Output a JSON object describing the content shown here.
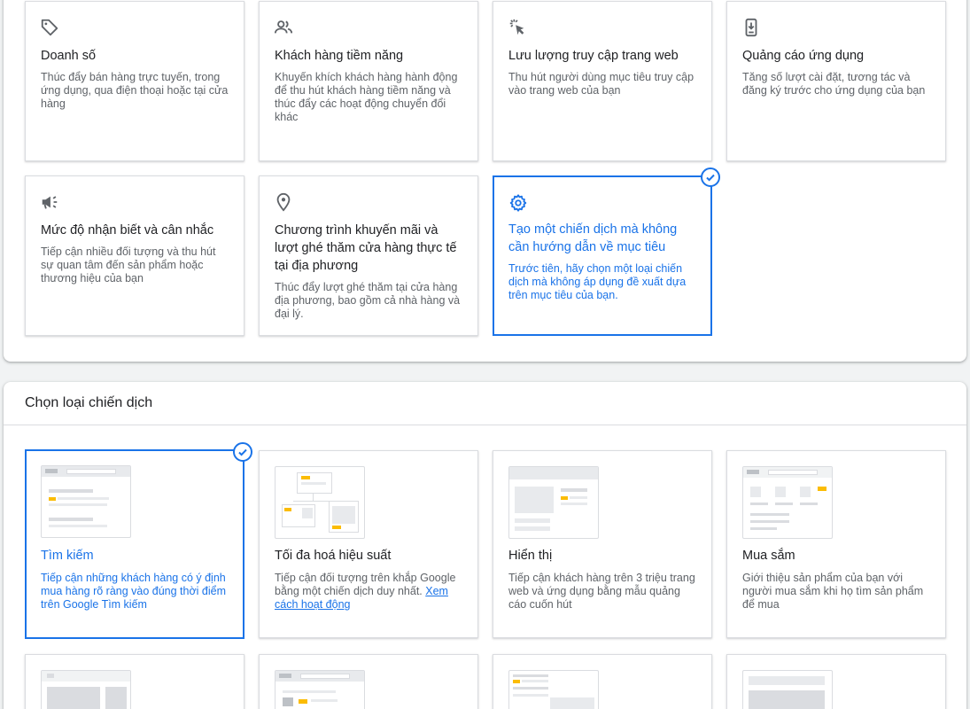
{
  "goals": {
    "cards": [
      {
        "title": "Doanh số",
        "desc": "Thúc đẩy bán hàng trực tuyến, trong ứng dụng, qua điện thoại hoặc tại cửa hàng",
        "icon": "tag-icon"
      },
      {
        "title": "Khách hàng tiềm năng",
        "desc": "Khuyến khích khách hàng hành động để thu hút khách hàng tiềm năng và thúc đẩy các hoạt động chuyển đổi khác",
        "icon": "people-icon"
      },
      {
        "title": "Lưu lượng truy cập trang web",
        "desc": "Thu hút người dùng mục tiêu truy cập vào trang web của bạn",
        "icon": "cursor-click-icon"
      },
      {
        "title": "Quảng cáo ứng dụng",
        "desc": "Tăng số lượt cài đặt, tương tác và đăng ký trước cho ứng dụng của bạn",
        "icon": "phone-download-icon"
      },
      {
        "title": "Mức độ nhận biết và cân nhắc",
        "desc": "Tiếp cận nhiều đối tượng và thu hút sự quan tâm đến sản phẩm hoặc thương hiệu của bạn",
        "icon": "megaphone-icon"
      },
      {
        "title": "Chương trình khuyến mãi và lượt ghé thăm cửa hàng thực tế tại địa phương",
        "desc": "Thúc đẩy lượt ghé thăm tại cửa hàng địa phương, bao gồm cả nhà hàng và đại lý.",
        "icon": "location-pin-icon"
      },
      {
        "title": "Tạo một chiến dịch mà không cần hướng dẫn về mục tiêu",
        "desc": "Trước tiên, hãy chọn một loại chiến dịch mà không áp dụng đề xuất dựa trên mục tiêu của bạn.",
        "icon": "gear-icon",
        "selected": true
      }
    ]
  },
  "campaign_types": {
    "title": "Chọn loại chiến dịch",
    "cards": [
      {
        "title": "Tìm kiếm",
        "desc": "Tiếp cận những khách hàng có ý định mua hàng rõ ràng vào đúng thời điểm trên Google Tìm kiếm",
        "selected": true
      },
      {
        "title": "Tối đa hoá hiệu suất",
        "desc": "Tiếp cận đối tượng trên khắp Google bằng một chiến dịch duy nhất.",
        "link": "Xem cách hoạt động"
      },
      {
        "title": "Hiển thị",
        "desc": "Tiếp cận khách hàng trên 3 triệu trang web và ứng dụng bằng mẫu quảng cáo cuốn hút"
      },
      {
        "title": "Mua sắm",
        "desc": "Giới thiệu sản phẩm của bạn với người mua sắm khi họ tìm sản phẩm để mua"
      }
    ]
  },
  "colors": {
    "accent": "#1a73e8",
    "thumb_highlight": "#fbbc04",
    "thumb_gray": "#dadce0"
  }
}
